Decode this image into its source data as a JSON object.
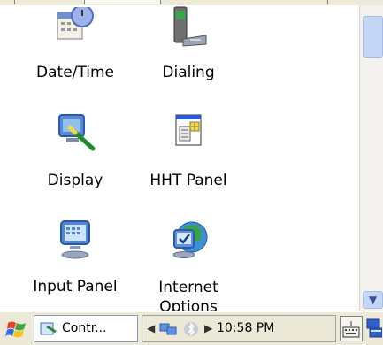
{
  "items": [
    {
      "label": "Date/Time",
      "icon": "clock-calendar-icon"
    },
    {
      "label": "Dialing",
      "icon": "phone-modem-icon"
    },
    {
      "label": "Display",
      "icon": "display-monitor-icon"
    },
    {
      "label": "HHT Panel",
      "icon": "hht-panel-icon"
    },
    {
      "label": "Input Panel",
      "icon": "input-panel-icon"
    },
    {
      "label": "Internet Options",
      "icon": "internet-options-icon"
    }
  ],
  "taskbar": {
    "task_label": "Contr...",
    "clock": "10:58 PM"
  }
}
